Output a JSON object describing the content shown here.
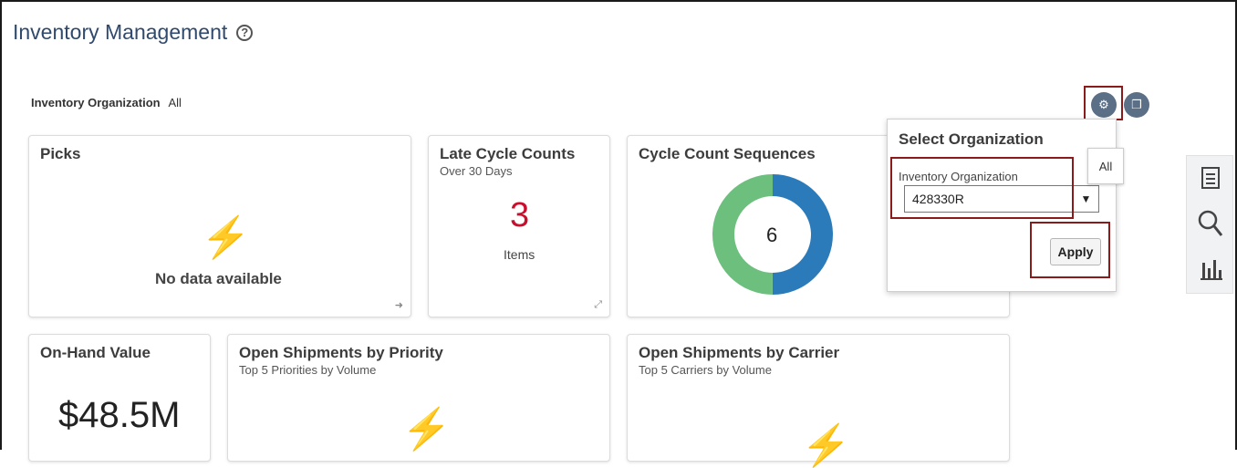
{
  "page": {
    "title": "Inventory Management"
  },
  "org_filter": {
    "label": "Inventory Organization",
    "value": "All"
  },
  "cards": {
    "picks": {
      "title": "Picks",
      "empty": "No data available"
    },
    "late_cycle": {
      "title": "Late Cycle Counts",
      "subtitle": "Over 30 Days",
      "value": "3",
      "unit": "Items"
    },
    "cycle_seq": {
      "title": "Cycle Count Sequences",
      "center": "6"
    },
    "onhand": {
      "title": "On-Hand Value",
      "value": "$48.5M"
    },
    "ship_priority": {
      "title": "Open Shipments by Priority",
      "subtitle": "Top 5 Priorities by Volume"
    },
    "ship_carrier": {
      "title": "Open Shipments by Carrier",
      "subtitle": "Top 5 Carriers by Volume"
    }
  },
  "popup": {
    "title": "Select Organization",
    "field_label": "Inventory Organization",
    "field_value": "428330R",
    "apply_label": "Apply",
    "tooltip": "All"
  },
  "chart_data": {
    "type": "pie",
    "title": "Cycle Count Sequences",
    "donut_total": 6,
    "slices": [
      {
        "value": 0.5,
        "color": "#2b7bba"
      },
      {
        "value": 0.5,
        "color": "#6cbf7d"
      }
    ]
  },
  "colors": {
    "accent_red": "#c8102e",
    "bolt": "#f5c518",
    "title_blue": "#2f4a6d",
    "highlight": "#8b1a1a"
  },
  "icons": {
    "help": "help-icon",
    "bolt": "lightning-icon",
    "settings": "settings-icon",
    "layout": "layout-icon",
    "document": "document-icon",
    "search": "search-icon",
    "chart": "bar-chart-icon"
  }
}
